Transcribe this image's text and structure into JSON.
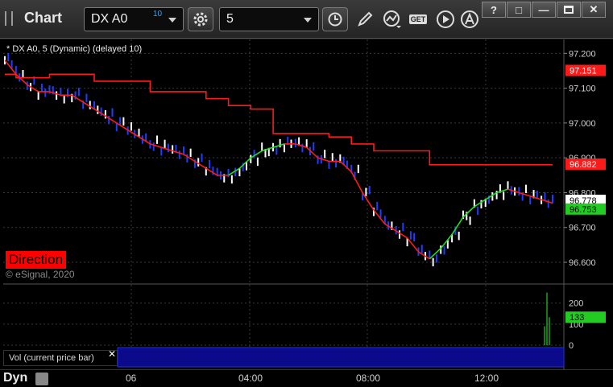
{
  "toolbar": {
    "app_title": "Chart",
    "symbol_value": "DX A0",
    "symbol_superscript": "10",
    "interval_value": "5",
    "get_label": "GET",
    "window_buttons": [
      "?",
      "□",
      "—",
      "✕"
    ]
  },
  "chart": {
    "legend_text": "* DX A0, 5 (Dynamic) (delayed 10)",
    "direction_label": "Direction",
    "copyright": "© eSignal, 2020",
    "vol_label": "Vol (current price bar)",
    "vol_close": "✕",
    "price_axis": [
      "97.200",
      "97.100",
      "97.000",
      "96.900",
      "96.800",
      "96.700",
      "96.600"
    ],
    "price_tags": [
      {
        "value": "97.151",
        "color": "#ff1a1a"
      },
      {
        "value": "96.882",
        "color": "#ff1a1a"
      },
      {
        "value": "96.778",
        "color": "#ffffff"
      },
      {
        "value": "96.753",
        "color": "#22cc22"
      }
    ],
    "volume_axis": [
      "200",
      "100",
      "0"
    ],
    "volume_tag": "133",
    "colors": {
      "up": "#ffffff",
      "down": "#1f3cff",
      "ma_down": "#ff1a1a",
      "ma_up": "#22dd22",
      "stop": "#ff1a1a"
    }
  },
  "chart_data": {
    "type": "line",
    "title": "",
    "xlabel": "",
    "ylabel": "",
    "ylim": [
      96.54,
      97.24
    ],
    "x_ticks": [
      "06",
      "04:00",
      "08:00",
      "12:00"
    ],
    "series": [
      {
        "values": [
          97.14,
          97.13,
          97.13,
          97.13,
          97.14,
          97.14,
          97.14,
          97.14,
          97.12,
          97.12,
          97.12,
          97.12,
          97.12,
          97.09,
          97.09,
          97.09,
          97.09,
          97.09,
          97.07,
          97.07,
          97.05,
          97.05,
          97.04,
          97.04,
          96.97,
          96.97,
          96.97,
          96.97,
          96.97,
          96.96,
          96.96,
          96.94,
          96.94,
          96.92,
          96.92,
          96.92,
          96.92,
          96.92,
          96.88,
          96.88,
          96.88,
          96.88,
          96.88,
          96.88,
          96.88,
          96.88,
          96.88,
          96.88,
          96.88,
          96.88
        ]
      },
      {
        "values": [
          97.18,
          97.14,
          97.11,
          97.09,
          97.09,
          97.08,
          97.08,
          97.06,
          97.04,
          97.02,
          97.0,
          96.98,
          96.96,
          96.94,
          96.93,
          96.92,
          96.91,
          96.89,
          96.87,
          96.85,
          96.85,
          96.87,
          96.9,
          96.92,
          96.93,
          96.94,
          96.94,
          96.93,
          96.9,
          96.89,
          96.89,
          96.86,
          96.8,
          96.75,
          96.71,
          96.69,
          96.67,
          96.63,
          96.61,
          96.64,
          96.68,
          96.73,
          96.76,
          96.78,
          96.8,
          96.81,
          96.8,
          96.79,
          96.78,
          96.77
        ]
      }
    ],
    "volume": [
      0,
      0,
      0,
      0,
      0,
      0,
      0,
      0,
      0,
      0,
      0,
      0,
      0,
      0,
      0,
      0,
      0,
      0,
      0,
      0,
      0,
      0,
      0,
      0,
      0,
      0,
      0,
      0,
      0,
      0,
      0,
      0,
      0,
      0,
      0,
      0,
      0,
      0,
      0,
      0,
      0,
      0,
      0,
      0,
      0,
      0,
      0,
      90,
      250,
      133
    ]
  },
  "bottom_bar": {
    "dyn_label": "Dyn"
  }
}
